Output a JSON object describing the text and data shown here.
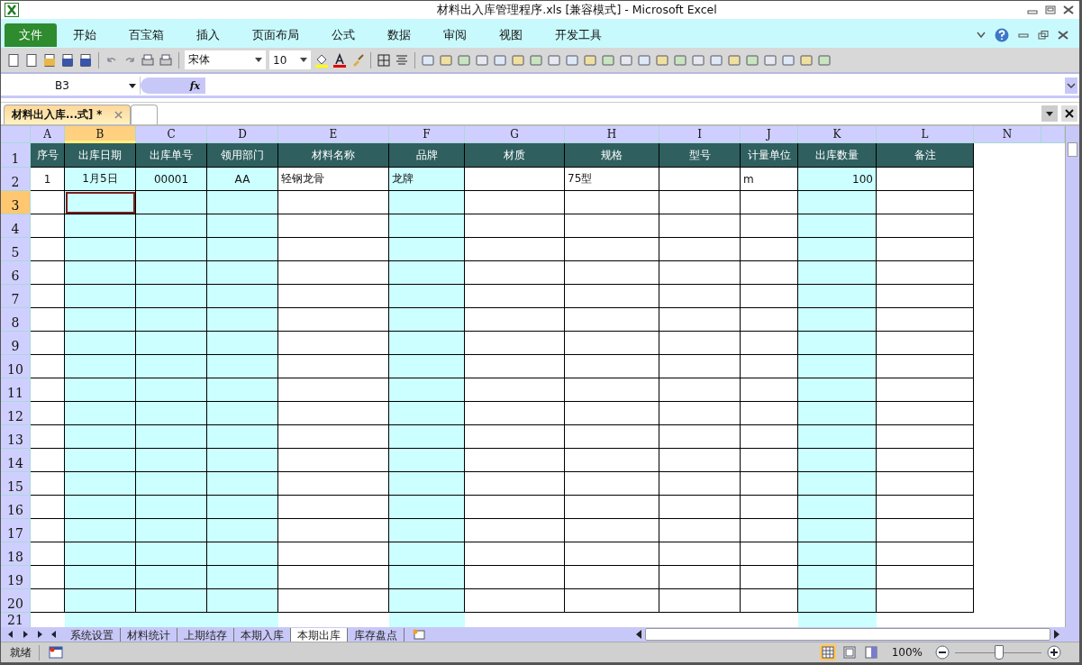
{
  "window": {
    "title": "材料出入库管理程序.xls  [兼容模式]  -  Microsoft Excel"
  },
  "menu": [
    {
      "label": "文件",
      "selected": true
    },
    {
      "label": "开始",
      "selected": false
    },
    {
      "label": "百宝箱",
      "selected": false
    },
    {
      "label": "插入",
      "selected": false
    },
    {
      "label": "页面布局",
      "selected": false
    },
    {
      "label": "公式",
      "selected": false
    },
    {
      "label": "数据",
      "selected": false
    },
    {
      "label": "审阅",
      "selected": false
    },
    {
      "label": "视图",
      "selected": false
    },
    {
      "label": "开发工具",
      "selected": false
    }
  ],
  "toolbar": {
    "font": "宋体",
    "size": "10"
  },
  "formula_bar": {
    "name_box": "B3",
    "fx": "fx"
  },
  "document_tabs": [
    {
      "label": "材料出入库...式] *",
      "selected": true
    },
    {
      "selected": false
    }
  ],
  "columns": [
    {
      "letter": "A",
      "header": "序号",
      "shaded": false,
      "selected": false
    },
    {
      "letter": "B",
      "header": "出库日期",
      "shaded": true,
      "selected": true
    },
    {
      "letter": "C",
      "header": "出库单号",
      "shaded": true,
      "selected": false
    },
    {
      "letter": "D",
      "header": "领用部门",
      "shaded": true,
      "selected": false
    },
    {
      "letter": "E",
      "header": "材料名称",
      "shaded": false,
      "selected": false
    },
    {
      "letter": "F",
      "header": "品牌",
      "shaded": true,
      "selected": false
    },
    {
      "letter": "G",
      "header": "材质",
      "shaded": false,
      "selected": false
    },
    {
      "letter": "H",
      "header": "规格",
      "shaded": false,
      "selected": false
    },
    {
      "letter": "I",
      "header": "型号",
      "shaded": false,
      "selected": false
    },
    {
      "letter": "J",
      "header": "计量单位",
      "shaded": false,
      "selected": false
    },
    {
      "letter": "K",
      "header": "出库数量",
      "shaded": true,
      "selected": false
    },
    {
      "letter": "L",
      "header": "备注",
      "shaded": false,
      "selected": false
    },
    {
      "letter": "N",
      "shaded": false,
      "selected": false
    }
  ],
  "rows": [
    {
      "number": "1",
      "kind": "header",
      "selected": false
    },
    {
      "number": "2",
      "kind": "data",
      "selected": false,
      "values": {
        "A": "1",
        "B": "1月5日",
        "C": "00001",
        "D": "AA",
        "E": "轻钢龙骨",
        "F": "龙牌",
        "H": "75型",
        "J": "m",
        "K": "100"
      }
    },
    {
      "number": "3",
      "kind": "data",
      "selected": true
    },
    {
      "number": "4",
      "kind": "data",
      "selected": false
    },
    {
      "number": "5",
      "kind": "data",
      "selected": false
    },
    {
      "number": "6",
      "kind": "data",
      "selected": false
    },
    {
      "number": "7",
      "kind": "data",
      "selected": false
    },
    {
      "number": "8",
      "kind": "data",
      "selected": false
    },
    {
      "number": "9",
      "kind": "data",
      "selected": false
    },
    {
      "number": "10",
      "kind": "data",
      "selected": false
    },
    {
      "number": "11",
      "kind": "data",
      "selected": false
    },
    {
      "number": "12",
      "kind": "data",
      "selected": false
    },
    {
      "number": "13",
      "kind": "data",
      "selected": false
    },
    {
      "number": "14",
      "kind": "data",
      "selected": false
    },
    {
      "number": "15",
      "kind": "data",
      "selected": false
    },
    {
      "number": "16",
      "kind": "data",
      "selected": false
    },
    {
      "number": "17",
      "kind": "data",
      "selected": false
    },
    {
      "number": "18",
      "kind": "data",
      "selected": false
    },
    {
      "number": "19",
      "kind": "data",
      "selected": false
    },
    {
      "number": "20",
      "kind": "data",
      "selected": false
    },
    {
      "number": "21",
      "kind": "cut",
      "selected": false
    }
  ],
  "sheet_tabs": [
    {
      "label": "系统设置",
      "selected": false
    },
    {
      "label": "材料统计",
      "selected": false
    },
    {
      "label": "上期结存",
      "selected": false
    },
    {
      "label": "本期入库",
      "selected": false
    },
    {
      "label": "本期出库",
      "selected": true
    },
    {
      "label": "库存盘点",
      "selected": false
    }
  ],
  "status_bar": {
    "status": "就绪",
    "zoom": "100%",
    "zoom_slider": {
      "level": 0.5
    },
    "views": [
      {
        "kind": "normal",
        "selected": true
      },
      {
        "kind": "layout",
        "selected": false
      },
      {
        "kind": "pagebreak",
        "selected": false
      }
    ]
  }
}
